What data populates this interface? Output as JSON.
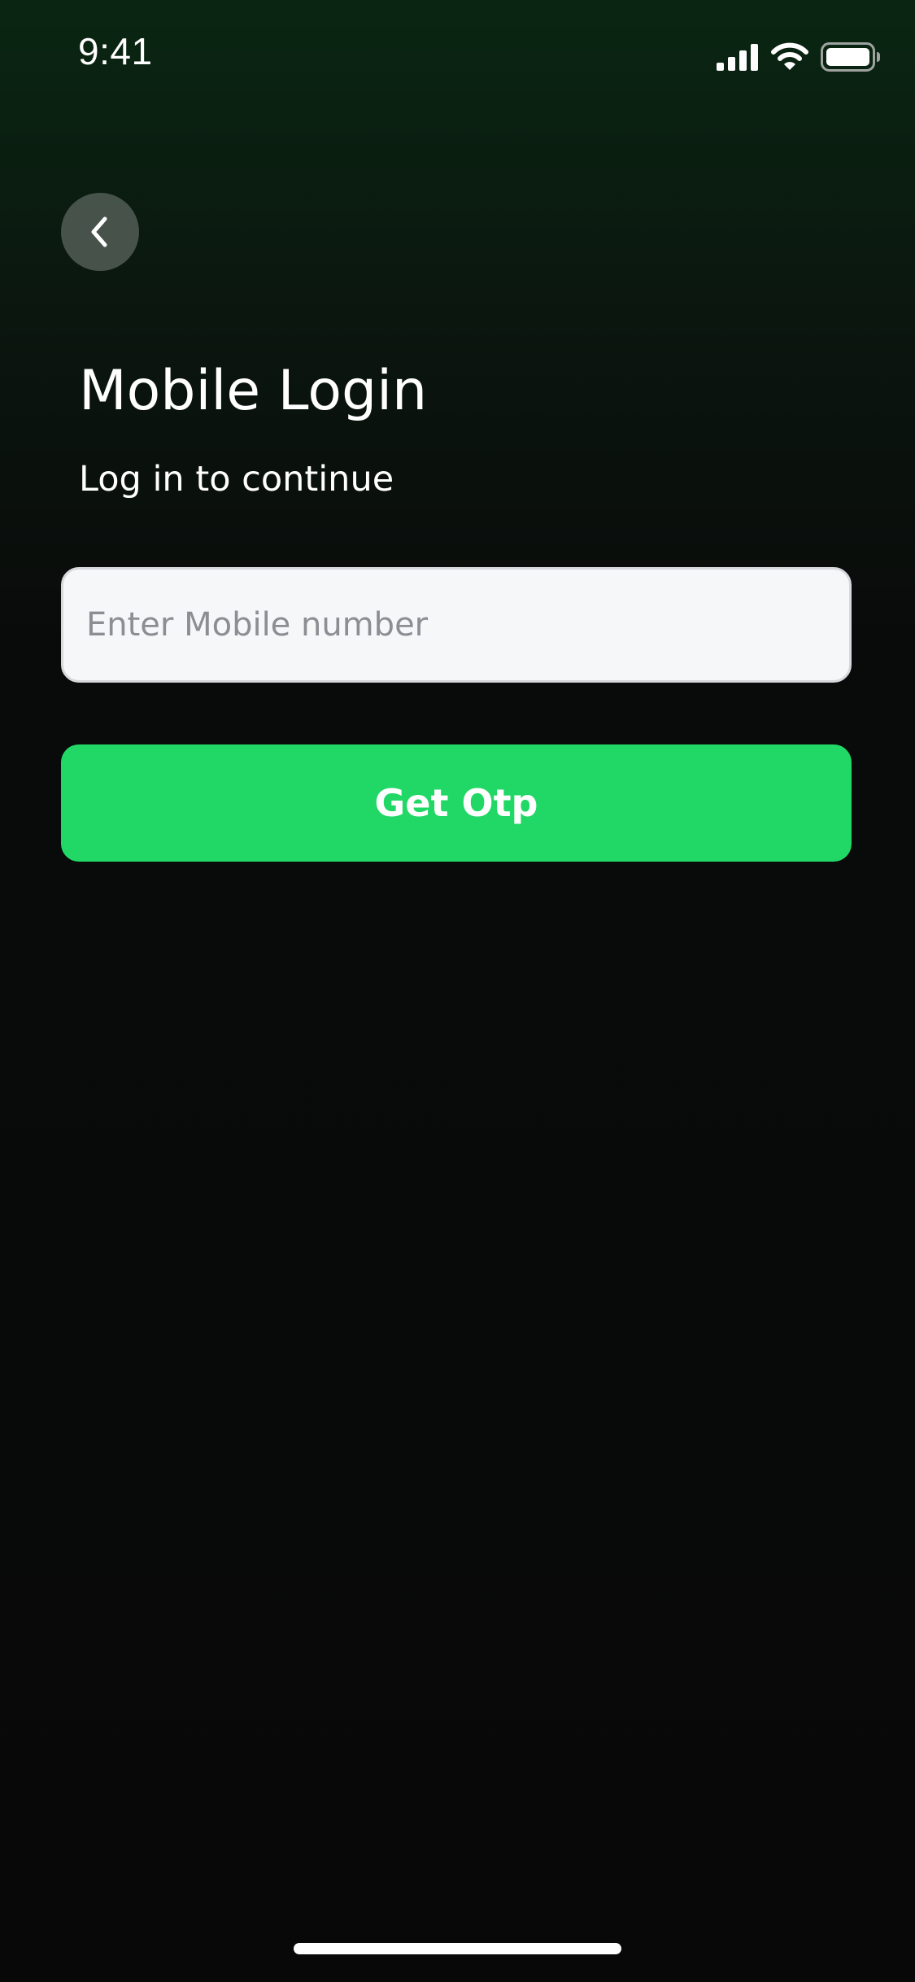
{
  "status_bar": {
    "time": "9:41",
    "icons": [
      "cellular-signal-icon",
      "wifi-icon",
      "battery-icon"
    ]
  },
  "header": {
    "back_icon": "chevron-left-icon"
  },
  "main": {
    "title": "Mobile Login",
    "subtitle": "Log in to continue",
    "mobile_input": {
      "value": "",
      "placeholder": "Enter Mobile number"
    },
    "get_otp_label": "Get Otp"
  },
  "colors": {
    "accent": "#21d866",
    "background_top": "#0a2612",
    "background": "#080808",
    "input_background": "#f6f7f9",
    "placeholder": "#8b8e92"
  }
}
